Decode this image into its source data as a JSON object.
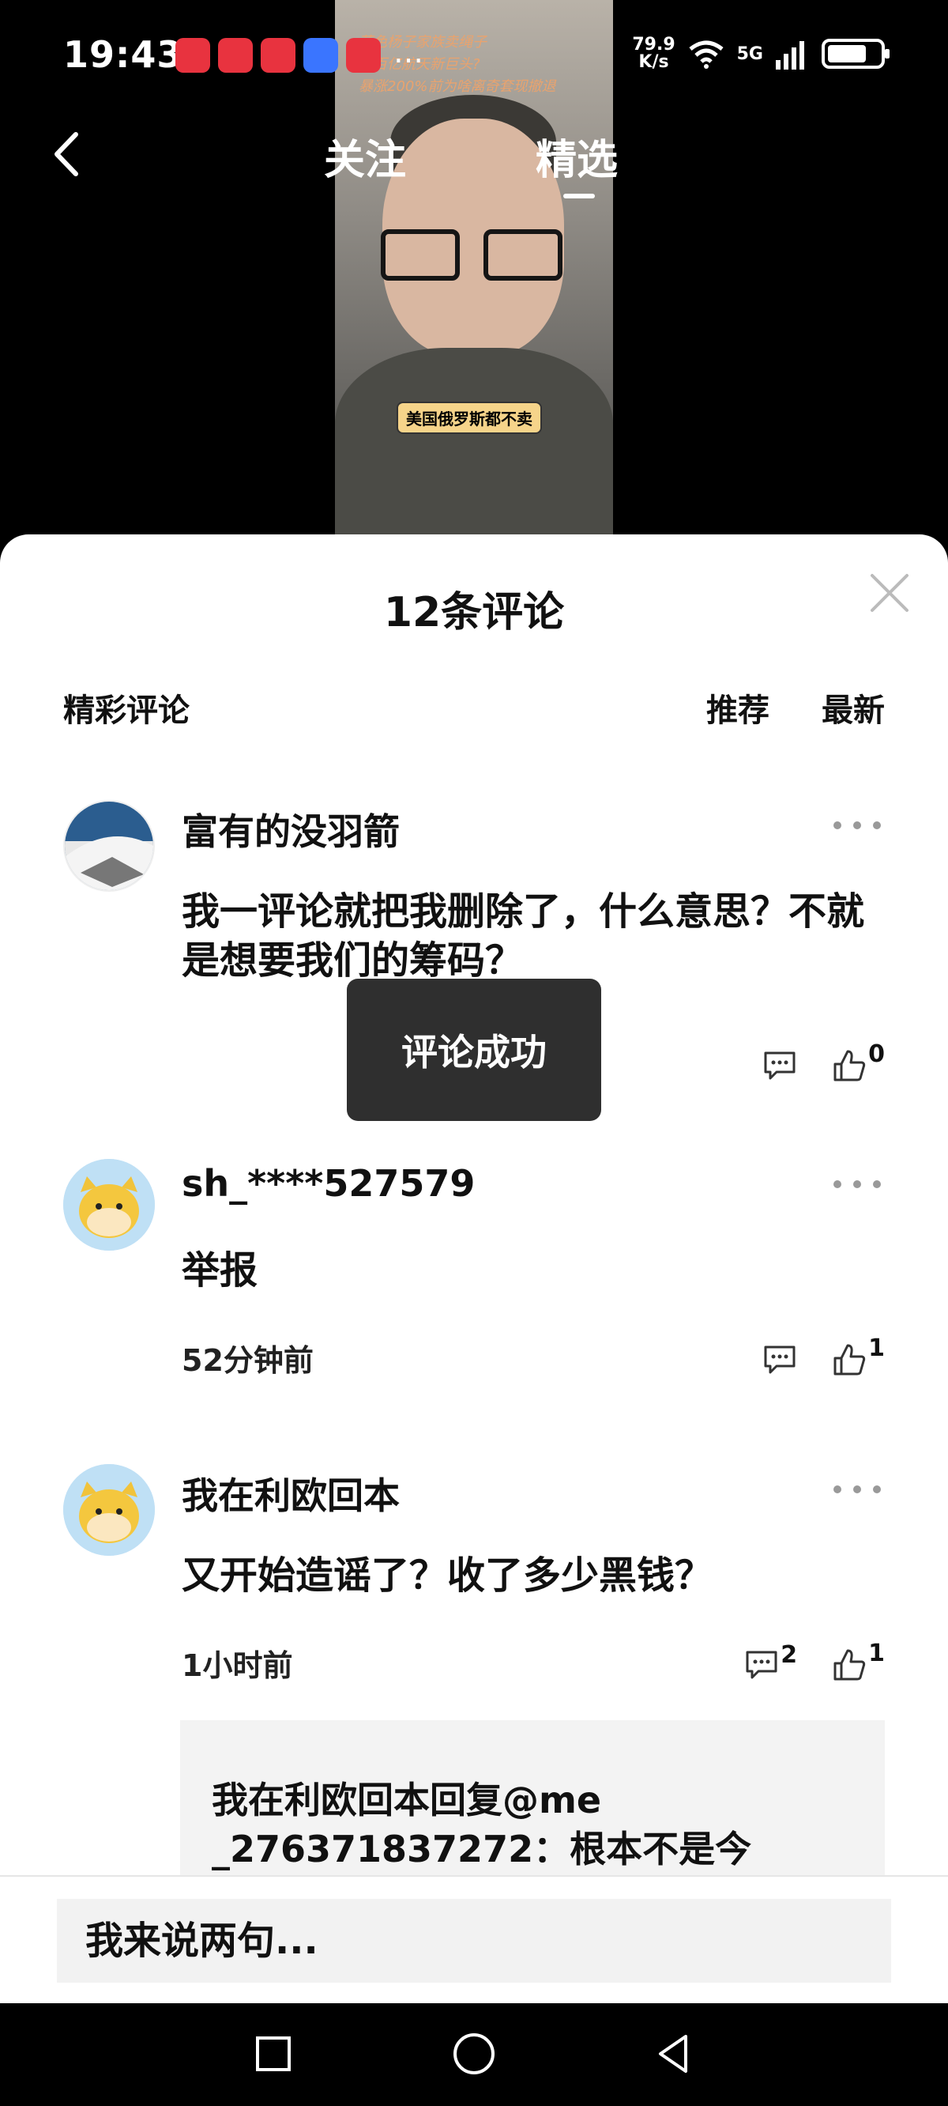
{
  "status_bar": {
    "time": "19:43",
    "more_indicator": "…",
    "net_speed_value": "79.9",
    "net_speed_unit": "K/s",
    "network": "5G",
    "battery_level": 0.75
  },
  "video": {
    "banner_line1": "蓝色杨子家族卖绳子",
    "banner_line2": "成百亿航天新巨头?",
    "banner_line3": "暴涨200%前为啥离奇套现撤退",
    "caption": "美国俄罗斯都不卖"
  },
  "top_tabs": {
    "follow": "关注",
    "featured": "精选"
  },
  "comments_panel": {
    "title": "12条评论",
    "section_label": "精彩评论",
    "sort_recommend": "推荐",
    "sort_latest": "最新"
  },
  "comments": [
    {
      "author": "富有的没羽箭",
      "text": "我一评论就把我删除了，什么意思？不就是想要我们的筹码？",
      "time": "",
      "likes": "0",
      "replies": ""
    },
    {
      "author": "sh_****527579",
      "text": "举报",
      "time": "52分钟前",
      "likes": "1",
      "replies": ""
    },
    {
      "author": "我在利欧回本",
      "text": "又开始造谣了？收了多少黑钱？",
      "time": "1小时前",
      "likes": "1",
      "replies": "2"
    }
  ],
  "reply_preview": {
    "text": "我在利欧回本回复@me _276371837272：根本不是今"
  },
  "toast": "评论成功",
  "input_placeholder": "我来说两句..."
}
